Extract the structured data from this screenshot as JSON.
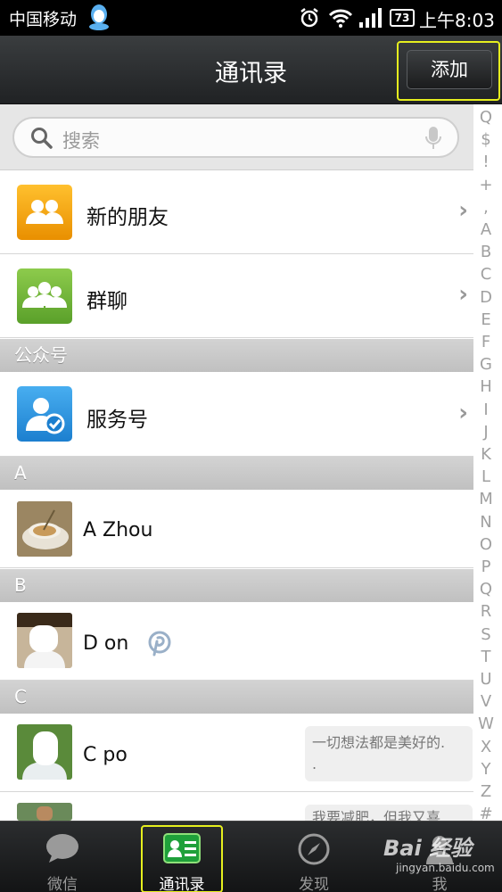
{
  "status_bar": {
    "carrier": "中国移动",
    "battery": "73",
    "time": "上午8:03"
  },
  "header": {
    "title": "通讯录",
    "add_label": "添加"
  },
  "search": {
    "placeholder": "搜索"
  },
  "rows": {
    "new_friends": "新的朋友",
    "group_chat": "群聊",
    "service": "服务号"
  },
  "sections": {
    "official": "公众号",
    "a": "A",
    "b": "B",
    "c": "C"
  },
  "contacts": [
    {
      "name": "A       Zhou",
      "status": ""
    },
    {
      "name": "D      on",
      "status": ""
    },
    {
      "name": "C      po",
      "status": "一切想法都是美好的."
    },
    {
      "name": "",
      "status": "我要减肥，但我又喜"
    }
  ],
  "status_tail": ".",
  "index_letters": [
    "Q",
    "$",
    "!",
    "+",
    ",",
    "A",
    "B",
    "C",
    "D",
    "E",
    "F",
    "G",
    "H",
    "I",
    "J",
    "K",
    "L",
    "M",
    "N",
    "O",
    "P",
    "Q",
    "R",
    "S",
    "T",
    "U",
    "V",
    "W",
    "X",
    "Y",
    "Z",
    "#"
  ],
  "tabs": {
    "chats": "微信",
    "contacts": "通讯录",
    "discover": "发现",
    "me": "我"
  },
  "watermark": {
    "brand": "Bai 经验",
    "url": "jingyan.baidu.com"
  },
  "colors": {
    "highlight": "#e6ef1e",
    "new_friends_tile": "#f2a000",
    "group_tile": "#6fb23a",
    "service_tile": "#2b91d9"
  }
}
